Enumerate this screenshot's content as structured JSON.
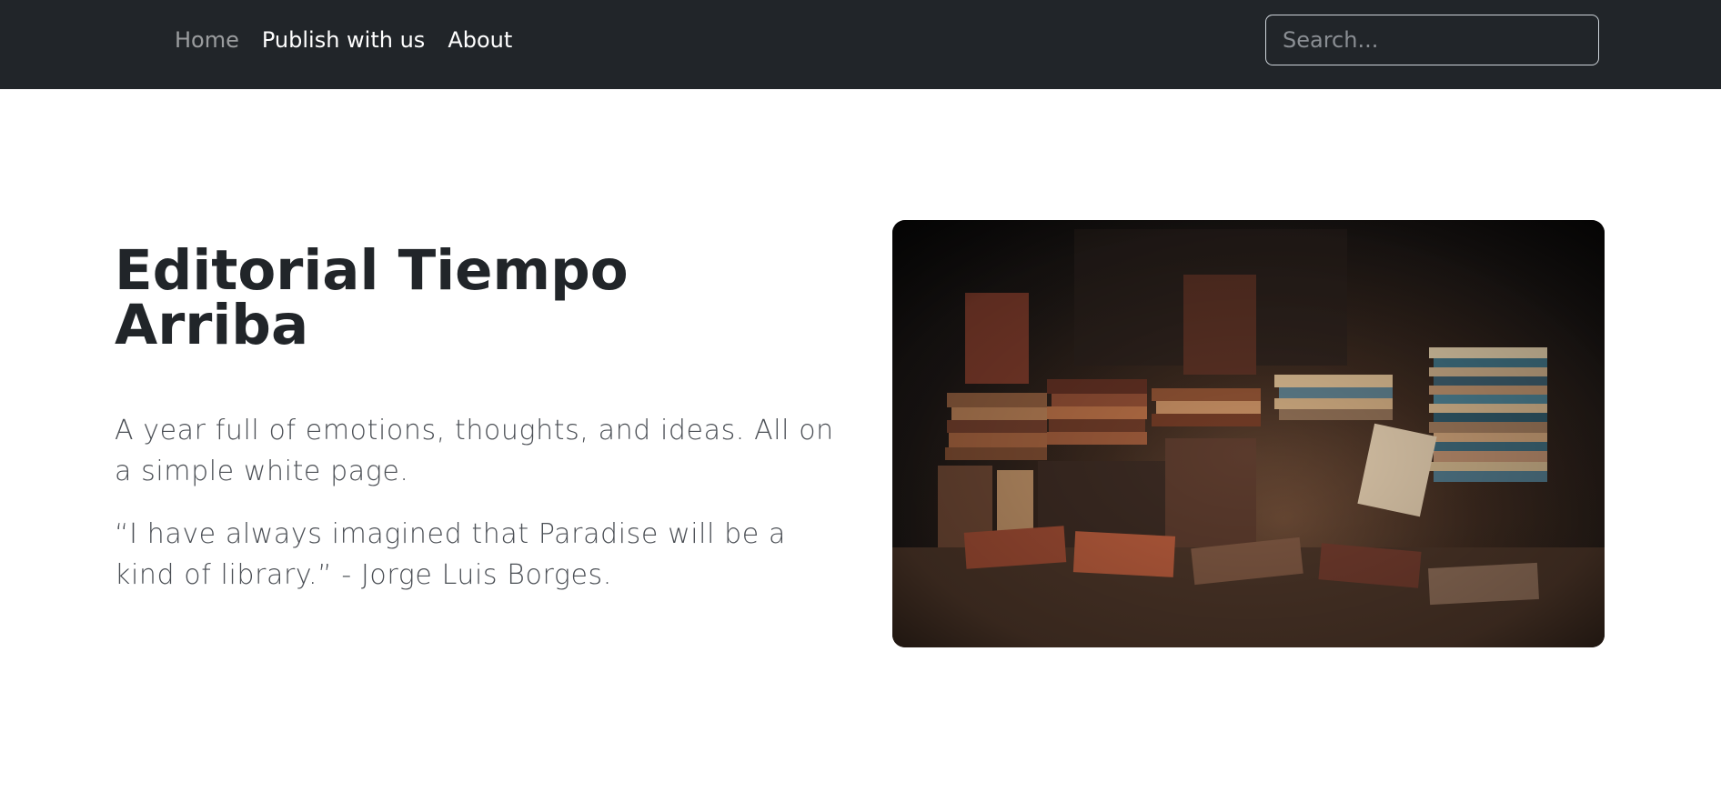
{
  "nav": {
    "items": [
      {
        "label": "Home",
        "active": true
      },
      {
        "label": "Publish with us",
        "active": false
      },
      {
        "label": "About",
        "active": false
      }
    ],
    "search_placeholder": "Search..."
  },
  "hero": {
    "title": "Editorial Tiempo Arriba",
    "lead1": "A year full of emotions, thoughts, and ideas. All on a simple white page.",
    "lead2": "“I have always imagined that Paradise will be a kind of library.” - Jorge Luis Borges."
  },
  "colors": {
    "navbar_bg": "#212529",
    "nav_active": "rgba(255,255,255,0.55)",
    "text_dark": "#212529",
    "text_muted": "#4b4f55"
  },
  "icons": {
    "hero_image": "bookstore-photo"
  }
}
